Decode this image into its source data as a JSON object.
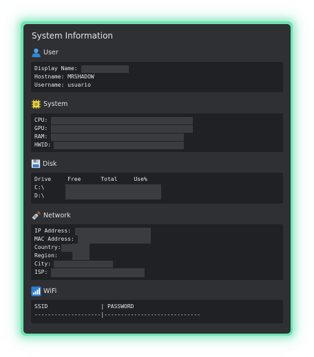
{
  "window": {
    "title": "System Information"
  },
  "sections": {
    "user": {
      "title": "User",
      "icon": "user-icon",
      "lines": [
        "Display Name:",
        "Hostname: MRSHADOW",
        "Username: usuario"
      ]
    },
    "system": {
      "title": "System",
      "icon": "chip-icon",
      "lines": [
        "CPU:",
        "GPU:",
        "RAM:",
        "HWID:"
      ]
    },
    "disk": {
      "title": "Disk",
      "icon": "floppy-disk-icon",
      "header": "Drive     Free      Total     Use%",
      "drives": [
        "C:\\",
        "D:\\"
      ]
    },
    "network": {
      "title": "Network",
      "icon": "satellite-icon",
      "lines": [
        "IP Address:",
        "MAC Address:",
        "Country:",
        "Region:",
        "City:",
        "ISP:"
      ]
    },
    "wifi": {
      "title": "WiFi",
      "icon": "signal-bars-icon",
      "header": "SSID                | PASSWORD",
      "divider": "--------------------|-----------------------------"
    }
  },
  "colors": {
    "accent_glow": "#6fe3b2",
    "panel": "#2e3033",
    "box": "#1f2124",
    "redaction": "#3a3c40"
  }
}
